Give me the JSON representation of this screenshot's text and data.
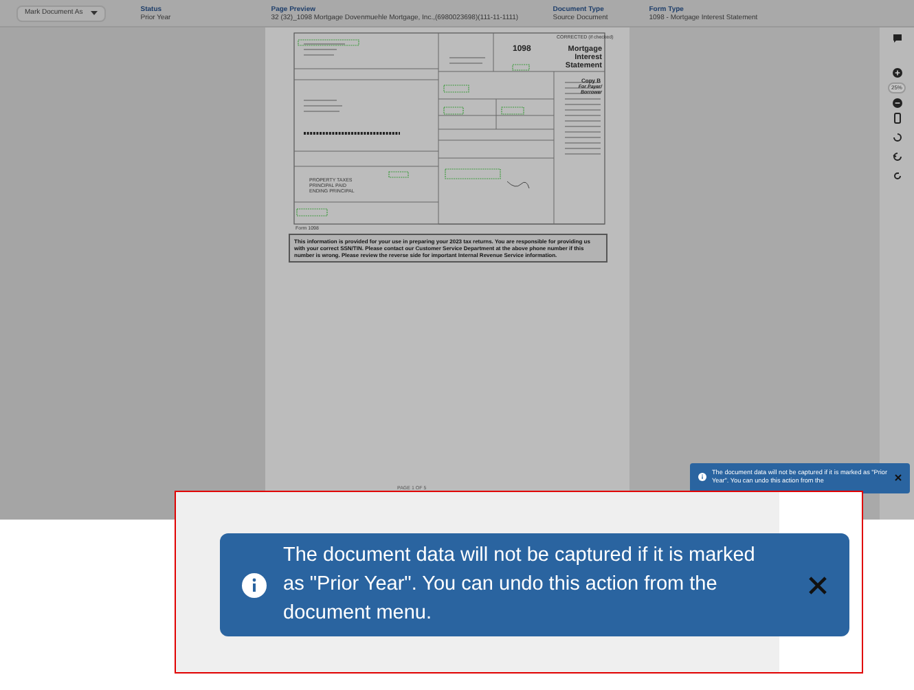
{
  "header": {
    "menu_button": "Mark Document As",
    "fields": [
      {
        "label": "Status",
        "value": "Prior Year"
      },
      {
        "label": "Page Preview",
        "value": "32 (32)_1098 Mortgage Dovenmuehle Mortgage, Inc.,(6980023698)(111-11-1111)"
      },
      {
        "label": "Document Type",
        "value": "Source Document"
      },
      {
        "label": "Form Type",
        "value": "1098 - Mortgage Interest Statement"
      }
    ]
  },
  "document": {
    "corrected": "CORRECTED (if checked)",
    "form_number": "1098",
    "title": "Mortgage Interest Statement",
    "copy": "Copy B",
    "copy_note": "For Payer/ Borrower",
    "amounts": [
      {
        "label": "PROPERTY TAXES"
      },
      {
        "label": "PRINCIPAL PAID"
      },
      {
        "label": "ENDING PRINCIPAL"
      }
    ],
    "form_label": "Form 1098",
    "notice": "This information is provided for your use in preparing your 2023 tax returns.  You are responsible for providing us with your correct SSN/TIN.  Please contact our Customer Service Department at the above phone number if this number is wrong.  Please review the reverse side for important Internal Revenue Service information.",
    "page_label": "PAGE 1 OF 5"
  },
  "toolbar": {
    "zoom": "25%"
  },
  "toast": {
    "message": "The document data will not be captured if it is marked as \"Prior Year\". You can undo this action from the"
  },
  "callout": {
    "message": "The document data will not be captured if it is marked as \"Prior Year\". You can undo this action from the document menu."
  }
}
